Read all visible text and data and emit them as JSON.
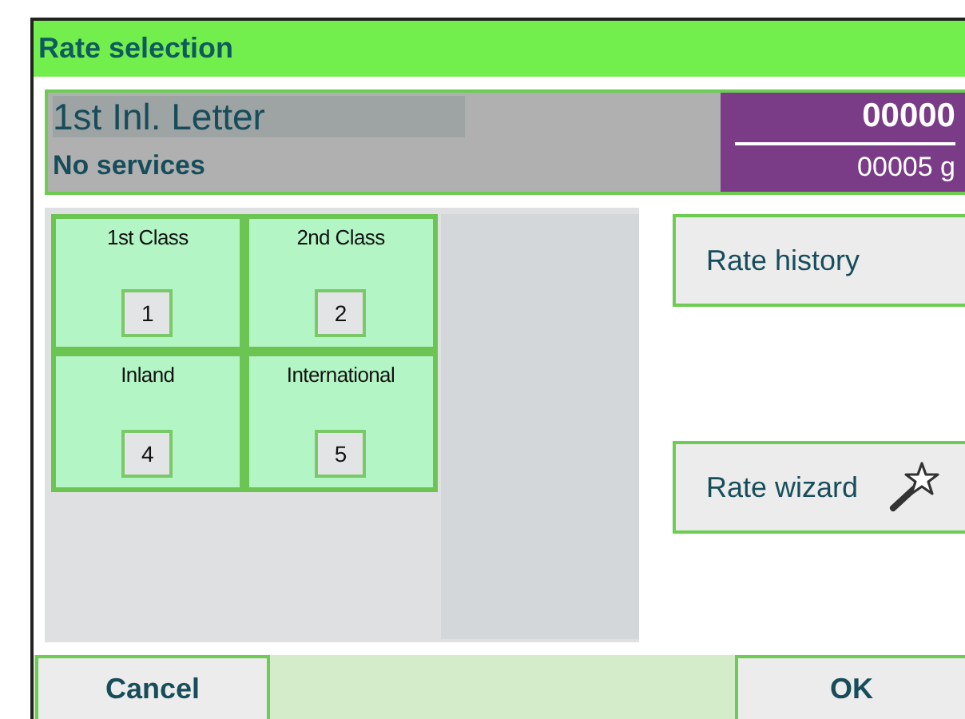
{
  "window": {
    "title": "Rate selection"
  },
  "rate": {
    "name": "1st Inl. Letter",
    "services": "No services",
    "amount": "00000",
    "weight": "00005 g"
  },
  "tiles": [
    {
      "label": "1st Class",
      "key": "1"
    },
    {
      "label": "2nd Class",
      "key": "2"
    },
    {
      "label": "Inland",
      "key": "4"
    },
    {
      "label": "International",
      "key": "5"
    }
  ],
  "side_buttons": [
    {
      "label": "Rate history",
      "kind": "plain"
    },
    {
      "label": "Rate wizard",
      "kind": "wizard"
    }
  ],
  "footer": {
    "cancel": "Cancel",
    "ok": "OK"
  }
}
